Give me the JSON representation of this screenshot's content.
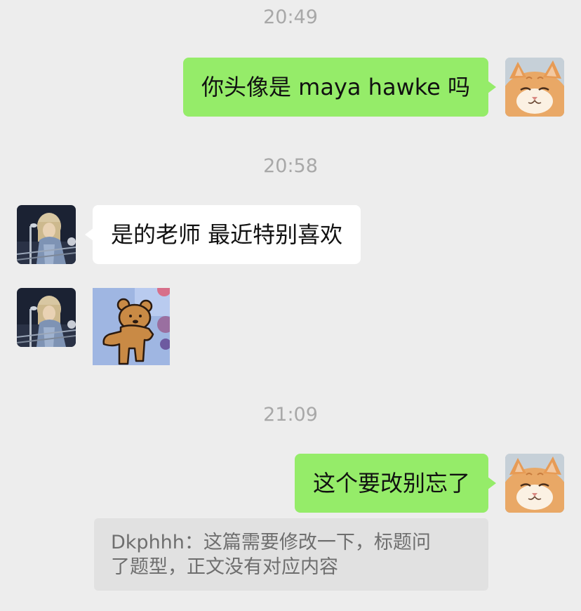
{
  "chat": {
    "timestamps": [
      "20:49",
      "20:58",
      "21:09"
    ],
    "messages": [
      {
        "sender": "me",
        "text": "你头像是 maya hawke 吗",
        "avatar_icon": "cat-avatar-icon"
      },
      {
        "sender": "contact",
        "text": "是的老师 最近特别喜欢",
        "avatar_icon": "singer-avatar-icon"
      },
      {
        "sender": "contact",
        "sticker_icon": "teddy-bear-sticker-icon",
        "avatar_icon": "singer-avatar-icon"
      },
      {
        "sender": "me",
        "text": "这个要改别忘了",
        "avatar_icon": "cat-avatar-icon"
      }
    ],
    "quote": {
      "author": "Dkphhh",
      "separator": "：",
      "line1": "这篇需要修改一下，标题问",
      "line2": "了题型，正文没有对应内容"
    }
  },
  "colors": {
    "background": "#ededed",
    "sent_bubble": "#95ec69",
    "received_bubble": "#ffffff",
    "timestamp_text": "#a8a8a8",
    "quote_background": "#e1e1e1"
  }
}
